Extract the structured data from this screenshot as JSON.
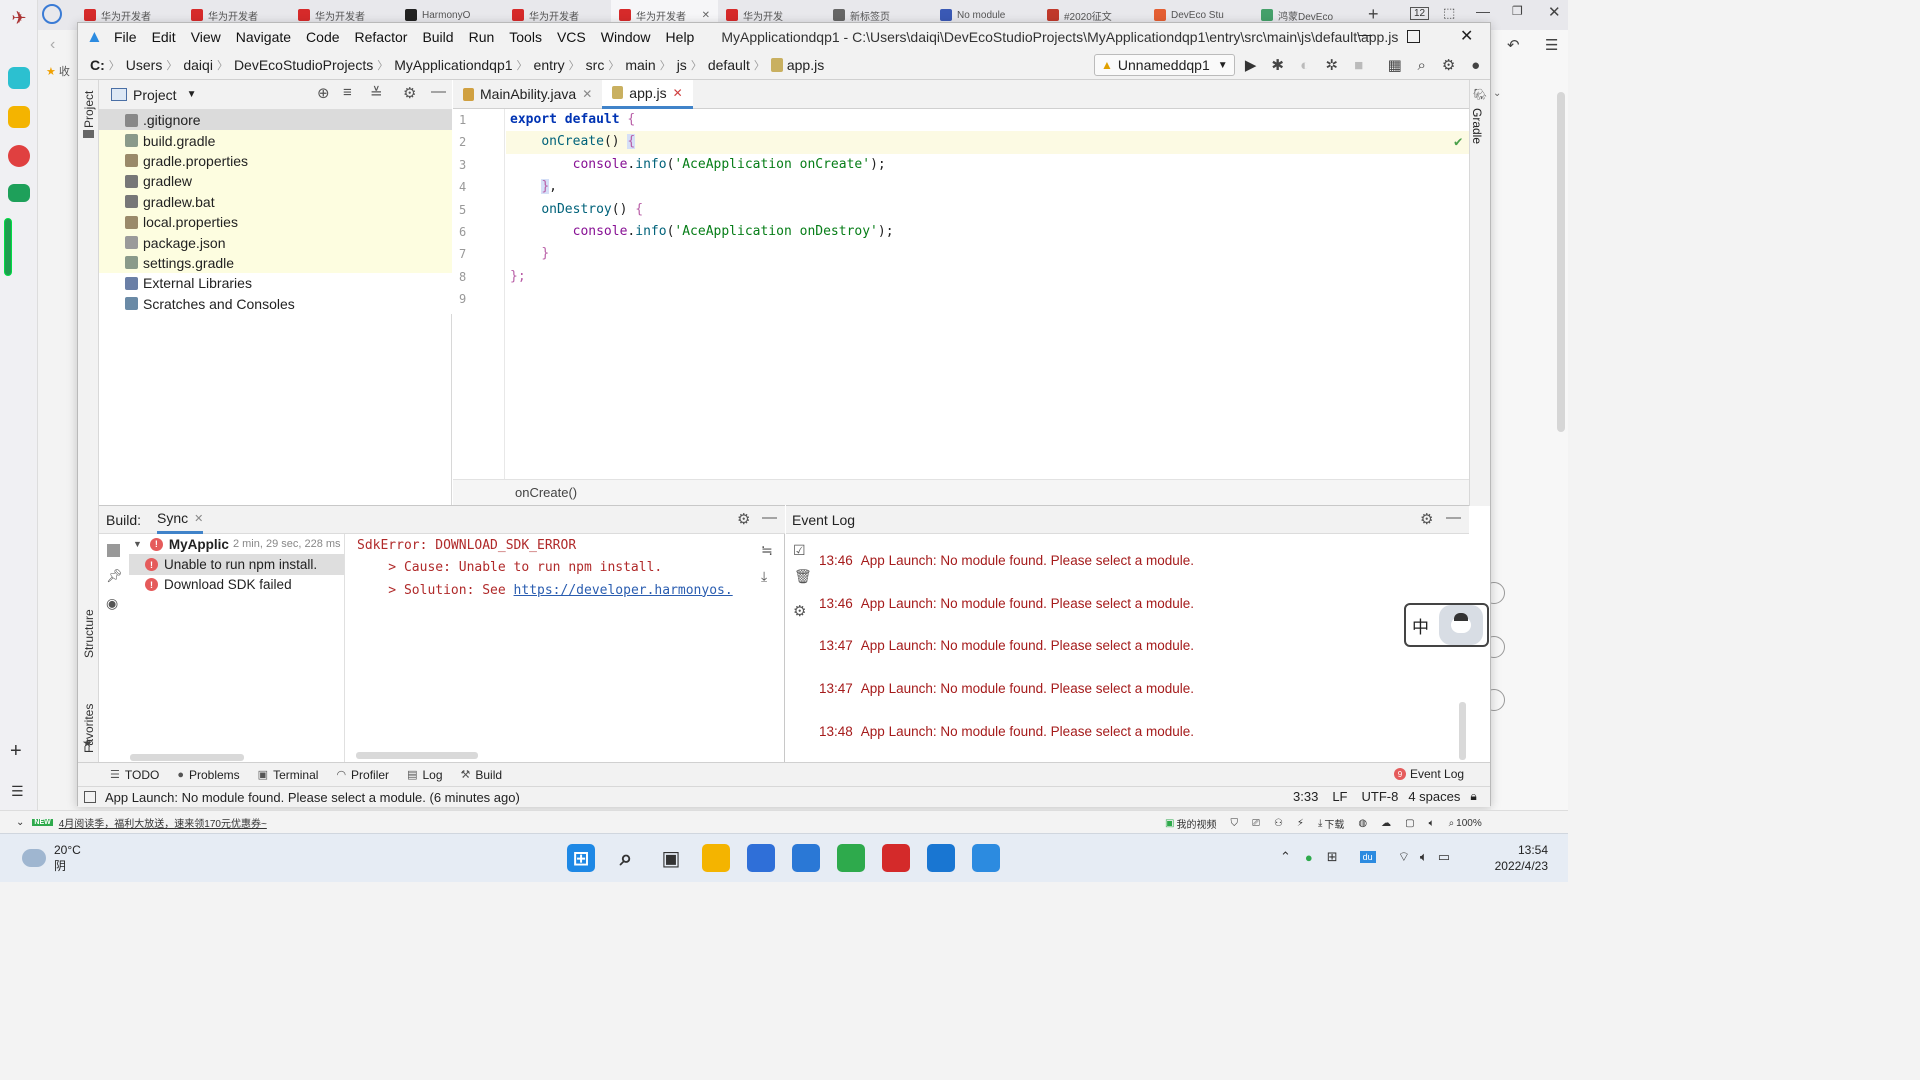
{
  "browser": {
    "tabs": [
      {
        "label": "华为开发者",
        "favcolor": "#d62a2a",
        "active": false
      },
      {
        "label": "华为开发者",
        "favcolor": "#d62a2a",
        "active": false
      },
      {
        "label": "华为开发者",
        "favcolor": "#d62a2a",
        "active": false
      },
      {
        "label": "HarmonyO",
        "favcolor": "#222222",
        "active": false
      },
      {
        "label": "华为开发者",
        "favcolor": "#d62a2a",
        "active": false
      },
      {
        "label": "华为开发者",
        "favcolor": "#d62a2a",
        "active": true
      },
      {
        "label": "华为开发",
        "favcolor": "#d62a2a",
        "active": false
      },
      {
        "label": "新标签页",
        "favcolor": "#666666",
        "active": false
      },
      {
        "label": "No module",
        "favcolor": "#3a59b5",
        "active": false
      },
      {
        "label": "#2020征文",
        "favcolor": "#c0392b",
        "active": false
      },
      {
        "label": "DevEco Stu",
        "favcolor": "#e45e32",
        "active": false
      },
      {
        "label": "鸿蒙DevEco",
        "favcolor": "#45a06a",
        "active": false
      }
    ],
    "tab_count": "12",
    "bookmark_label": "收",
    "status_promo": "4月阅读季，福利大放送，速来领170元优惠券~",
    "status_new_badge": "NEW",
    "status_right": {
      "video": "我的视频",
      "download": "下载",
      "zoom": "100%"
    }
  },
  "ide": {
    "title": "MyApplicationdqp1 - C:\\Users\\daiqi\\DevEcoStudioProjects\\MyApplicationdqp1\\entry\\src\\main\\js\\default\\app.js",
    "menu": [
      "File",
      "Edit",
      "View",
      "Navigate",
      "Code",
      "Refactor",
      "Build",
      "Run",
      "Tools",
      "VCS",
      "Window",
      "Help"
    ],
    "breadcrumb": [
      "C:",
      "Users",
      "daiqi",
      "DevEcoStudioProjects",
      "MyApplicationdqp1",
      "entry",
      "src",
      "main",
      "js",
      "default",
      "app.js"
    ],
    "run_config": "Unnameddqp1",
    "left_strip": {
      "project": "Project",
      "structure": "Structure",
      "favorites": "Favorites"
    },
    "right_strip": {
      "gradle": "Gradle"
    },
    "project_panel": {
      "title": "Project",
      "items": [
        {
          "label": ".gitignore",
          "icon": "gitignore-file-icon",
          "color": "#888888",
          "state": "sel"
        },
        {
          "label": "build.gradle",
          "icon": "gradle-file-icon",
          "color": "#8a9a8a",
          "state": "mod"
        },
        {
          "label": "gradle.properties",
          "icon": "properties-file-icon",
          "color": "#9a8a6a",
          "state": "mod"
        },
        {
          "label": "gradlew",
          "icon": "script-file-icon",
          "color": "#777777",
          "state": "mod"
        },
        {
          "label": "gradlew.bat",
          "icon": "bat-file-icon",
          "color": "#777777",
          "state": "mod"
        },
        {
          "label": "local.properties",
          "icon": "properties-file-icon",
          "color": "#9a8a6a",
          "state": "mod"
        },
        {
          "label": "package.json",
          "icon": "json-file-icon",
          "color": "#9a9a9a",
          "state": "mod"
        },
        {
          "label": "settings.gradle",
          "icon": "gradle-file-icon",
          "color": "#8a9a8a",
          "state": "mod"
        },
        {
          "label": "External Libraries",
          "icon": "library-icon",
          "color": "#6a7fa6",
          "state": "plain"
        },
        {
          "label": "Scratches and Consoles",
          "icon": "scratches-icon",
          "color": "#6a8aa6",
          "state": "plain"
        }
      ]
    },
    "editor": {
      "tabs": [
        {
          "label": "MainAbility.java",
          "active": false
        },
        {
          "label": "app.js",
          "active": true
        }
      ],
      "line_numbers": [
        "1",
        "2",
        "3",
        "4",
        "5",
        "6",
        "7",
        "8",
        "9"
      ],
      "code": {
        "l1_kw": "export default",
        "l1_brace": " {",
        "l2_indent": "    ",
        "l2_fn": "onCreate",
        "l2_paren": "() ",
        "l2_brace": "{",
        "l3_indent": "        ",
        "l3_obj": "console",
        "l3_dot": ".",
        "l3_fn": "info",
        "l3_open": "(",
        "l3_str": "'AceApplication onCreate'",
        "l3_close": ");",
        "l4_indent": "    ",
        "l4_brace": "}",
        "l4_comma": ",",
        "l5_indent": "    ",
        "l5_fn": "onDestroy",
        "l5_paren": "() ",
        "l5_brace": "{",
        "l6_indent": "        ",
        "l6_obj": "console",
        "l6_dot": ".",
        "l6_fn": "info",
        "l6_open": "(",
        "l6_str": "'AceApplication onDestroy'",
        "l6_close": ");",
        "l7_indent": "    ",
        "l7_brace": "}",
        "l8_brace": "}",
        "l8_semi": ";"
      },
      "footer_crumb": "onCreate()"
    },
    "build": {
      "label": "Build:",
      "tab": "Sync",
      "tree": [
        {
          "label": "MyApplic",
          "meta": "2 min, 29 sec, 228 ms",
          "bold": true
        },
        {
          "label": "Unable to run npm install.",
          "selected": true
        },
        {
          "label": "Download SDK failed"
        }
      ],
      "output": {
        "l1": "SdkError: DOWNLOAD_SDK_ERROR",
        "l2": "    > Cause: Unable to run npm install.",
        "l3_prefix": "    > Solution: See ",
        "l3_link": "https://developer.harmonyos."
      }
    },
    "event_log": {
      "title": "Event Log",
      "entries": [
        {
          "time": "13:46",
          "text": "App Launch: No module found. Please select a module."
        },
        {
          "time": "13:46",
          "text": "App Launch: No module found. Please select a module."
        },
        {
          "time": "13:47",
          "text": "App Launch: No module found. Please select a module."
        },
        {
          "time": "13:47",
          "text": "App Launch: No module found. Please select a module."
        },
        {
          "time": "13:48",
          "text": "App Launch: No module found. Please select a module."
        }
      ]
    },
    "tool_tabs": [
      "TODO",
      "Problems",
      "Terminal",
      "Profiler",
      "Log",
      "Build"
    ],
    "event_log_tab": {
      "count": "9",
      "label": "Event Log"
    },
    "status": {
      "message": "App Launch: No module found. Please select a module. (6 minutes ago)",
      "position": "3:33",
      "line_sep": "LF",
      "encoding": "UTF-8",
      "indent": "4 spaces"
    },
    "ime_label": "中"
  },
  "taskbar": {
    "weather_temp": "20°C",
    "weather_desc": "阴",
    "time": "13:54",
    "date": "2022/4/23",
    "apps": [
      {
        "name": "start-icon",
        "color": "#1e88e5"
      },
      {
        "name": "search-icon",
        "color": "#333333"
      },
      {
        "name": "task-view-icon",
        "color": "#333333"
      },
      {
        "name": "file-explorer-icon",
        "color": "#f4b400"
      },
      {
        "name": "store-icon",
        "color": "#2f6fd8"
      },
      {
        "name": "mail-icon",
        "color": "#2a78d6"
      },
      {
        "name": "browser-icon",
        "color": "#2eaa4c"
      },
      {
        "name": "app-2-icon",
        "color": "#d42a2a"
      },
      {
        "name": "deveco-icon",
        "color": "#1976d2"
      },
      {
        "name": "deveco-2-icon",
        "color": "#2c8be0"
      }
    ]
  }
}
